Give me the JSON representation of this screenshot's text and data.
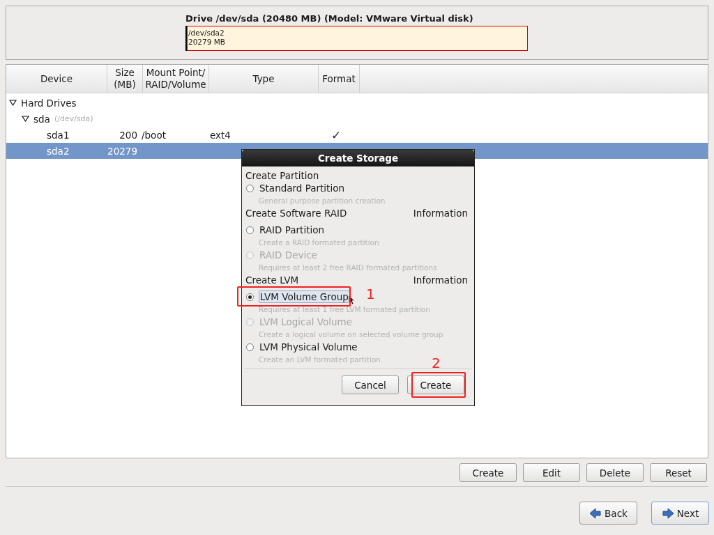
{
  "drive": {
    "title": "Drive /dev/sda (20480 MB) (Model: VMware Virtual disk)",
    "partitions": [
      {
        "name": "/dev/sda2",
        "size": "20279 MB",
        "selected": true
      }
    ]
  },
  "table": {
    "columns": [
      "Device",
      "Size\n(MB)",
      "Mount Point/\nRAID/Volume",
      "Type",
      "Format"
    ],
    "rows": [
      {
        "device": "Hard Drives",
        "expanded": true,
        "children": [
          {
            "device": "sda",
            "path": "(/dev/sda)",
            "expanded": true,
            "children": [
              {
                "device": "sda1",
                "size": "200",
                "mount": "/boot",
                "type": "ext4",
                "format": "✓",
                "selected": false
              },
              {
                "device": "sda2",
                "size": "20279",
                "selected": true
              }
            ]
          }
        ]
      }
    ]
  },
  "dialog": {
    "title": "Create Storage",
    "sections": [
      {
        "heading": "Create Partition",
        "options": [
          {
            "label": "Standard Partition",
            "description": "General purpose partition creation",
            "selected": false,
            "disabled": false
          }
        ]
      },
      {
        "heading": "Create Software RAID",
        "info": {
          "label": "Information"
        },
        "options": [
          {
            "label": "RAID Partition",
            "description": "Create a RAID formated partition",
            "selected": false,
            "disabled": false
          },
          {
            "label": "RAID Device",
            "description": "Requires at least 2 free RAID formated partitions",
            "selected": false,
            "disabled": true
          }
        ]
      },
      {
        "heading": "Create LVM",
        "info": {
          "label": "Information"
        },
        "options": [
          {
            "label": "LVM Volume Group",
            "description": "Requires at least 1 free LVM formated partition",
            "selected": true,
            "disabled": false,
            "annotation": "1"
          },
          {
            "label": "LVM Logical Volume",
            "description": "Create a logical volume on selected volume group",
            "selected": false,
            "disabled": true
          },
          {
            "label": "LVM Physical Volume",
            "description": "Create an LVM formated partition",
            "selected": false,
            "disabled": false
          }
        ]
      }
    ],
    "buttons": [
      {
        "label": "Cancel"
      },
      {
        "label": "Create",
        "annotation": "2"
      }
    ]
  },
  "actions": [
    {
      "label": "Create"
    },
    {
      "label": "Edit"
    },
    {
      "label": "Delete"
    },
    {
      "label": "Reset"
    }
  ],
  "navigation": [
    {
      "label": "Back",
      "kind": "back"
    },
    {
      "label": "Next",
      "kind": "next"
    }
  ]
}
